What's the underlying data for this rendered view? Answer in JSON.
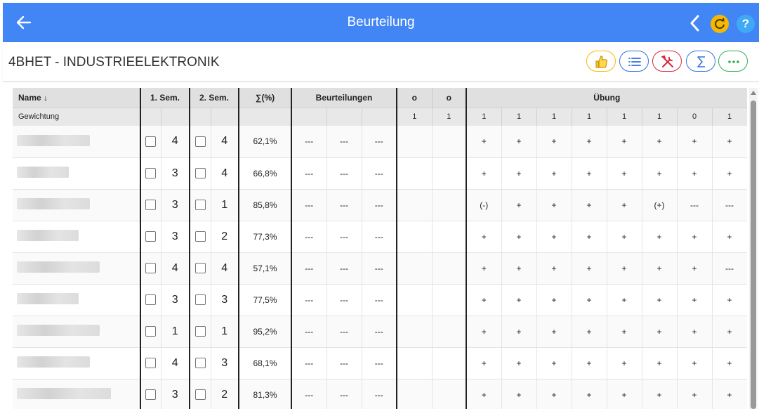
{
  "header": {
    "title": "Beurteilung"
  },
  "subheader": {
    "class_name": "4BHET - INDUSTRIEELEKTRONIK"
  },
  "toolbar": {
    "accent": "#4285f4",
    "icons": [
      "back-arrow-icon",
      "chevron-left-icon",
      "refresh-icon",
      "help-icon",
      "thumbs-up-icon",
      "list-icon",
      "tools-icon",
      "sum-icon",
      "more-icon"
    ],
    "help_label": "?"
  },
  "table": {
    "headers": {
      "name": "Name ↓",
      "sem1": "1. Sem.",
      "sem2": "2. Sem.",
      "percent": "∑(%)",
      "beurteilungen": "Beurteilungen",
      "o1": "o",
      "o2": "o",
      "uebung": "Übung"
    },
    "weight_row": {
      "label": "Gewichtung",
      "o_weights": [
        "1",
        "1"
      ],
      "uebung_weights": [
        "1",
        "1",
        "1",
        "1",
        "1",
        "1",
        "0",
        "1"
      ]
    },
    "rows": [
      {
        "sem1": "4",
        "sem2": "4",
        "percent": "62,1%",
        "beurteilungen": [
          "---",
          "---",
          "---"
        ],
        "uebung": [
          "+",
          "+",
          "+",
          "+",
          "+",
          "+",
          "+",
          "+"
        ]
      },
      {
        "sem1": "3",
        "sem2": "4",
        "percent": "66,8%",
        "beurteilungen": [
          "---",
          "---",
          "---"
        ],
        "uebung": [
          "+",
          "+",
          "+",
          "+",
          "+",
          "+",
          "+",
          "+"
        ]
      },
      {
        "sem1": "3",
        "sem2": "1",
        "percent": "85,8%",
        "beurteilungen": [
          "---",
          "---",
          "---"
        ],
        "uebung": [
          "(-)",
          "+",
          "+",
          "+",
          "+",
          "(+)",
          "---",
          "---"
        ]
      },
      {
        "sem1": "3",
        "sem2": "2",
        "percent": "77,3%",
        "beurteilungen": [
          "---",
          "---",
          "---"
        ],
        "uebung": [
          "+",
          "+",
          "+",
          "+",
          "+",
          "+",
          "+",
          "+"
        ]
      },
      {
        "sem1": "4",
        "sem2": "4",
        "percent": "57,1%",
        "beurteilungen": [
          "---",
          "---",
          "---"
        ],
        "uebung": [
          "+",
          "+",
          "+",
          "+",
          "+",
          "+",
          "+",
          "---"
        ]
      },
      {
        "sem1": "3",
        "sem2": "3",
        "percent": "77,5%",
        "beurteilungen": [
          "---",
          "---",
          "---"
        ],
        "uebung": [
          "+",
          "+",
          "+",
          "+",
          "+",
          "+",
          "+",
          "+"
        ]
      },
      {
        "sem1": "1",
        "sem2": "1",
        "percent": "95,2%",
        "beurteilungen": [
          "---",
          "---",
          "---"
        ],
        "uebung": [
          "+",
          "+",
          "+",
          "+",
          "+",
          "+",
          "+",
          "+"
        ]
      },
      {
        "sem1": "4",
        "sem2": "3",
        "percent": "68,1%",
        "beurteilungen": [
          "---",
          "---",
          "---"
        ],
        "uebung": [
          "+",
          "+",
          "+",
          "+",
          "+",
          "+",
          "+",
          "+"
        ]
      },
      {
        "sem1": "3",
        "sem2": "2",
        "percent": "81,3%",
        "beurteilungen": [
          "---",
          "---",
          "---"
        ],
        "uebung": [
          "+",
          "+",
          "+",
          "+",
          "+",
          "+",
          "+",
          "+"
        ]
      }
    ]
  }
}
